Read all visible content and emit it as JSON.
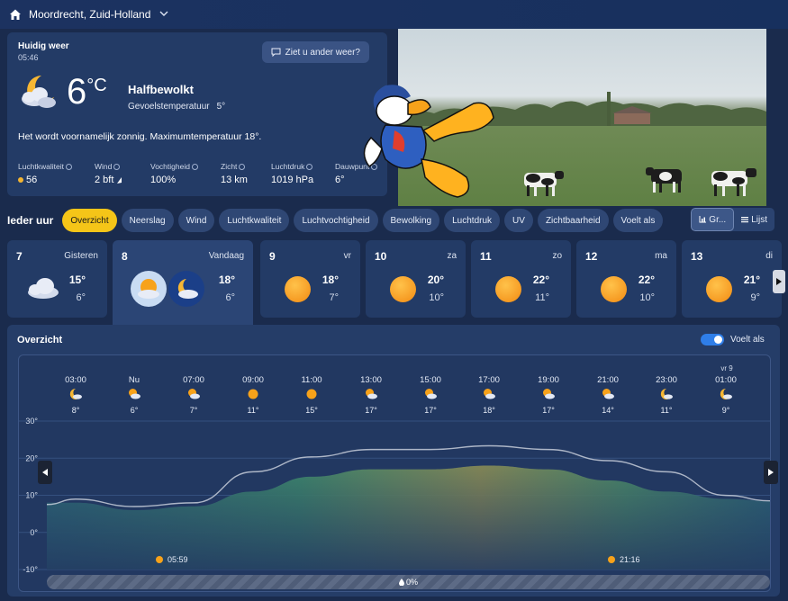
{
  "header": {
    "location": "Moordrecht, Zuid-Holland"
  },
  "current": {
    "title": "Huidig weer",
    "time": "05:46",
    "feedback_label": "Ziet u ander weer?",
    "temp": "6",
    "unit": "°C",
    "condition": "Halfbewolkt",
    "feels_label": "Gevoelstemperatuur",
    "feels_value": "5°",
    "summary": "Het wordt voornamelijk zonnig. Maximumtemperatuur 18°.",
    "metrics": [
      {
        "label": "Luchtkwaliteit",
        "value": "56"
      },
      {
        "label": "Wind",
        "value": "2 bft"
      },
      {
        "label": "Vochtigheid",
        "value": "100%"
      },
      {
        "label": "Zicht",
        "value": "13 km"
      },
      {
        "label": "Luchtdruk",
        "value": "1019 hPa"
      },
      {
        "label": "Dauwpunt",
        "value": "6°"
      }
    ]
  },
  "tabs": {
    "title": "Ieder uur",
    "items": [
      "Overzicht",
      "Neerslag",
      "Wind",
      "Luchtkwaliteit",
      "Luchtvochtigheid",
      "Bewolking",
      "Luchtdruk",
      "UV",
      "Zichtbaarheid",
      "Voelt als"
    ],
    "view_graph": "Gr...",
    "view_list": "Lijst"
  },
  "days": [
    {
      "num": "7",
      "name": "Gisteren",
      "hi": "15°",
      "lo": "6°",
      "icon": "cloud-icon"
    },
    {
      "num": "8",
      "name": "Vandaag",
      "hi": "18°",
      "lo": "6°",
      "icon": "sun-cloud-icon"
    },
    {
      "num": "9",
      "name": "vr",
      "hi": "18°",
      "lo": "7°",
      "icon": "sun-icon"
    },
    {
      "num": "10",
      "name": "za",
      "hi": "20°",
      "lo": "10°",
      "icon": "sun-icon"
    },
    {
      "num": "11",
      "name": "zo",
      "hi": "22°",
      "lo": "11°",
      "icon": "sun-icon"
    },
    {
      "num": "12",
      "name": "ma",
      "hi": "22°",
      "lo": "10°",
      "icon": "sun-icon"
    },
    {
      "num": "13",
      "name": "di",
      "hi": "21°",
      "lo": "9°",
      "icon": "sun-icon"
    }
  ],
  "overview": {
    "title": "Overzicht",
    "toggle_label": "Voelt als",
    "next_day_label": "vr 9",
    "sunrise": "05:59",
    "sunset": "21:16",
    "precip": "0%"
  },
  "chart_data": {
    "type": "area",
    "x": [
      "03:00",
      "Nu",
      "07:00",
      "09:00",
      "11:00",
      "13:00",
      "15:00",
      "17:00",
      "19:00",
      "21:00",
      "23:00",
      "01:00"
    ],
    "series": [
      {
        "values": [
          8,
          6,
          7,
          11,
          15,
          17,
          17,
          18,
          17,
          14,
          11,
          9
        ]
      }
    ],
    "hour_icons": [
      "moon-cloud-icon",
      "sun-cloud-icon",
      "sun-cloud-icon",
      "sun-icon",
      "sun-icon",
      "sun-cloud-icon",
      "sun-cloud-icon",
      "sun-cloud-icon",
      "sun-cloud-icon",
      "sun-cloud-icon",
      "moon-cloud-icon",
      "moon-cloud-icon"
    ],
    "y_ticks": [
      "30°",
      "20°",
      "10°",
      "0°",
      "-10°"
    ],
    "ylim": [
      -10,
      30
    ],
    "grid": true
  }
}
